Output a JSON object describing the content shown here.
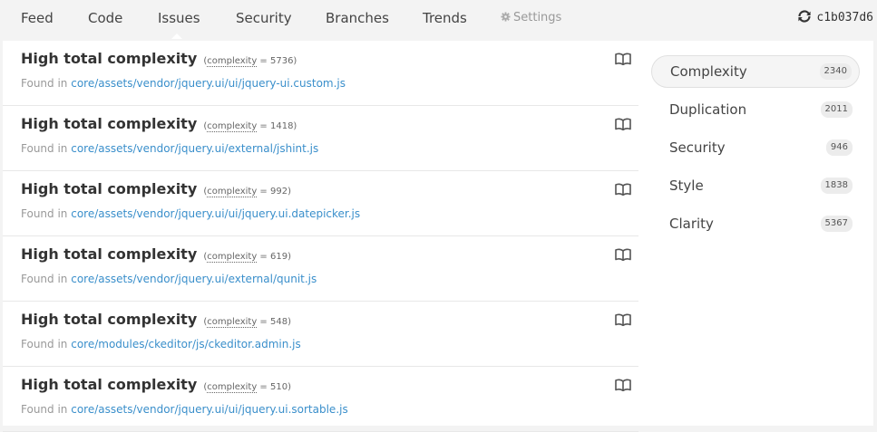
{
  "nav": {
    "items": [
      "Feed",
      "Code",
      "Issues",
      "Security",
      "Branches",
      "Trends"
    ],
    "active": "Issues",
    "settings_label": "Settings",
    "commit": "c1b037d6"
  },
  "issues": [
    {
      "title": "High total complexity",
      "metric_open": "(",
      "metric_key": "complexity",
      "metric_value": " = 5736)",
      "found_label": "Found in ",
      "path": "core/assets/vendor/jquery.ui/ui/jquery-ui.custom.js"
    },
    {
      "title": "High total complexity",
      "metric_open": "(",
      "metric_key": "complexity",
      "metric_value": " = 1418)",
      "found_label": "Found in ",
      "path": "core/assets/vendor/jquery.ui/external/jshint.js"
    },
    {
      "title": "High total complexity",
      "metric_open": "(",
      "metric_key": "complexity",
      "metric_value": " = 992)",
      "found_label": "Found in ",
      "path": "core/assets/vendor/jquery.ui/ui/jquery.ui.datepicker.js"
    },
    {
      "title": "High total complexity",
      "metric_open": "(",
      "metric_key": "complexity",
      "metric_value": " = 619)",
      "found_label": "Found in ",
      "path": "core/assets/vendor/jquery.ui/external/qunit.js"
    },
    {
      "title": "High total complexity",
      "metric_open": "(",
      "metric_key": "complexity",
      "metric_value": " = 548)",
      "found_label": "Found in ",
      "path": "core/modules/ckeditor/js/ckeditor.admin.js"
    },
    {
      "title": "High total complexity",
      "metric_open": "(",
      "metric_key": "complexity",
      "metric_value": " = 510)",
      "found_label": "Found in ",
      "path": "core/assets/vendor/jquery.ui/ui/jquery.ui.sortable.js"
    }
  ],
  "categories": [
    {
      "label": "Complexity",
      "count": "2340",
      "active": true
    },
    {
      "label": "Duplication",
      "count": "2011",
      "active": false
    },
    {
      "label": "Security",
      "count": "946",
      "active": false
    },
    {
      "label": "Style",
      "count": "1838",
      "active": false
    },
    {
      "label": "Clarity",
      "count": "5367",
      "active": false
    }
  ],
  "colors": {
    "link": "#3a8fcb",
    "text": "#333333",
    "muted": "#999999"
  }
}
